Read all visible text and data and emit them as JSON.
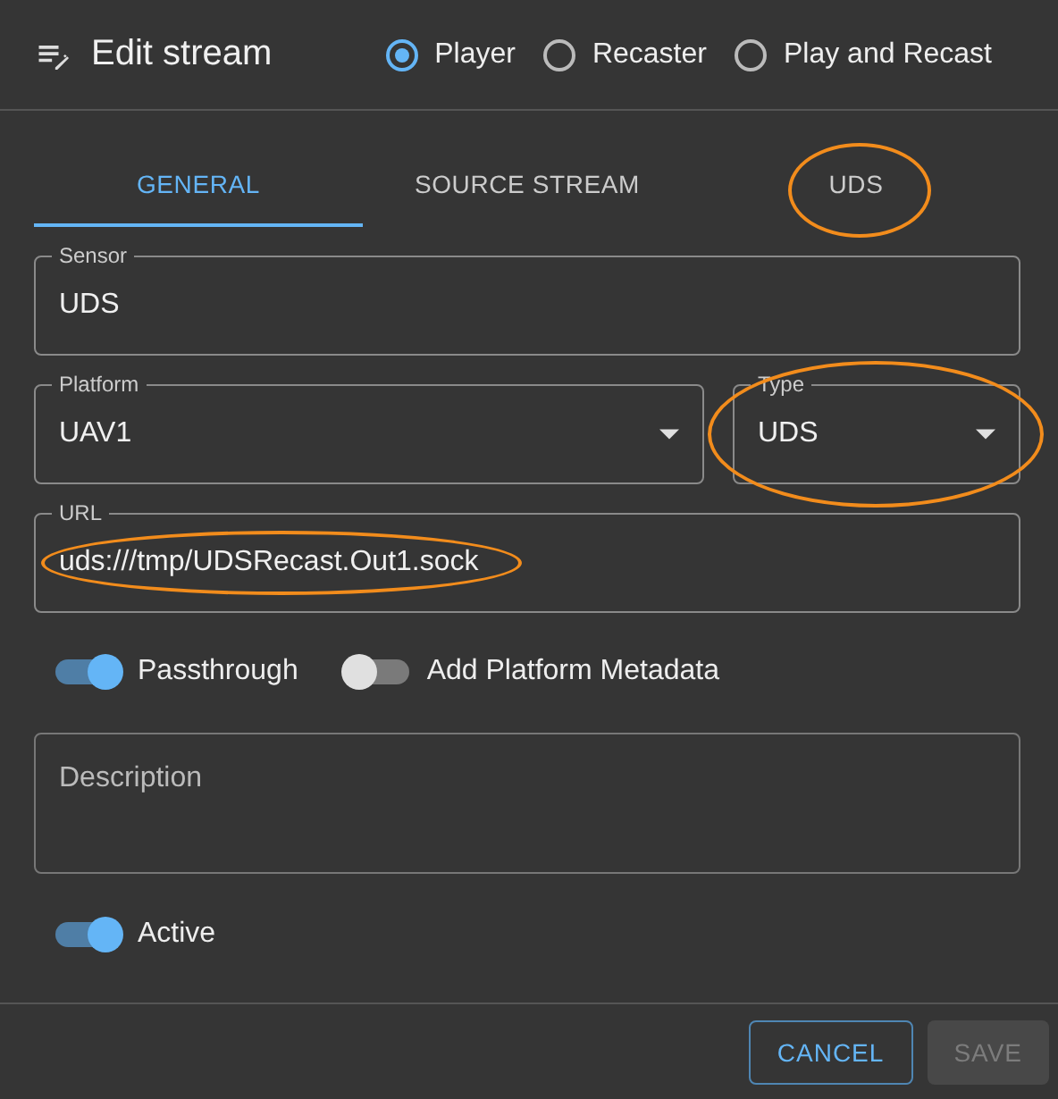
{
  "dialog": {
    "title": "Edit stream"
  },
  "modes": [
    {
      "label": "Player",
      "selected": true
    },
    {
      "label": "Recaster",
      "selected": false
    },
    {
      "label": "Play and Recast",
      "selected": false
    }
  ],
  "tabs": [
    {
      "label": "GENERAL",
      "selected": true,
      "highlighted": false
    },
    {
      "label": "SOURCE STREAM",
      "selected": false,
      "highlighted": false
    },
    {
      "label": "UDS",
      "selected": false,
      "highlighted": true
    }
  ],
  "fields": [
    {
      "kind": "text",
      "label": "Sensor",
      "value": "UDS",
      "highlighted": false
    },
    {
      "kind": "select",
      "label": "Platform",
      "value": "UAV1",
      "highlighted": false
    },
    {
      "kind": "select",
      "label": "Type",
      "value": "UDS",
      "highlighted": true
    },
    {
      "kind": "text",
      "label": "URL",
      "value": "uds:///tmp/UDSRecast.Out1.sock",
      "highlighted": true
    }
  ],
  "options": [
    {
      "label": "Passthrough",
      "on": true
    },
    {
      "label": "Add Platform Metadata",
      "on": false
    }
  ],
  "description": {
    "placeholder": "Description"
  },
  "active": {
    "label": "Active",
    "on": true
  },
  "buttons": [
    {
      "label": "CANCEL",
      "kind": "outlined",
      "disabled": false
    },
    {
      "label": "SAVE",
      "kind": "filled",
      "disabled": true
    }
  ]
}
